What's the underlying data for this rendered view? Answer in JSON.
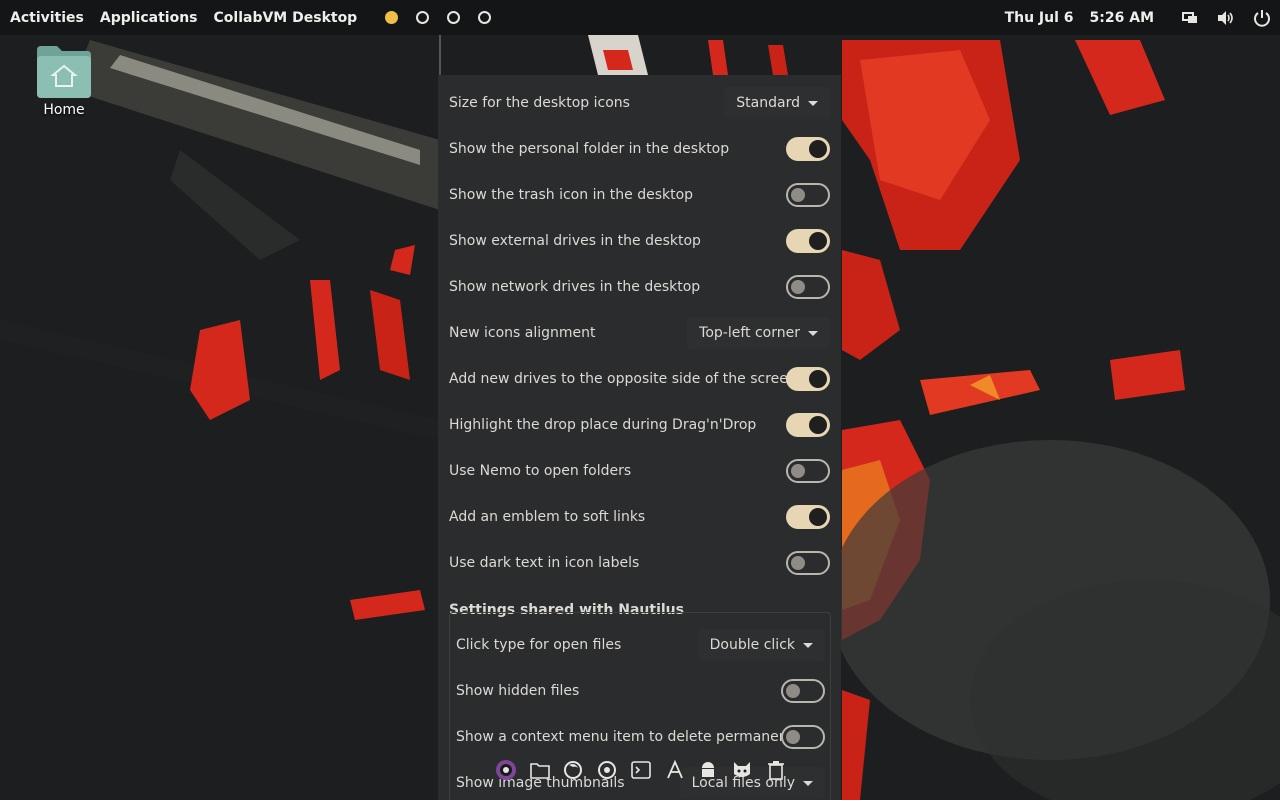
{
  "topbar": {
    "activities": "Activities",
    "applications": "Applications",
    "app_name": "CollabVM Desktop",
    "workspaces": [
      "active",
      "inactive",
      "inactive",
      "inactive"
    ],
    "date": "Thu Jul 6",
    "time": "5:26 AM",
    "icons": [
      "network-icon",
      "volume-icon",
      "power-icon"
    ]
  },
  "desktop": {
    "home_label": "Home"
  },
  "settings": {
    "rows": [
      {
        "label": "Size for the desktop icons",
        "type": "dropdown",
        "value": "Standard"
      },
      {
        "label": "Show the personal folder in the desktop",
        "type": "toggle",
        "on": true
      },
      {
        "label": "Show the trash icon in the desktop",
        "type": "toggle",
        "on": false
      },
      {
        "label": "Show external drives in the desktop",
        "type": "toggle",
        "on": true
      },
      {
        "label": "Show network drives in the desktop",
        "type": "toggle",
        "on": false
      },
      {
        "label": "New icons alignment",
        "type": "dropdown",
        "value": "Top-left corner"
      },
      {
        "label": "Add new drives to the opposite side of the screen",
        "type": "toggle",
        "on": true
      },
      {
        "label": "Highlight the drop place during Drag'n'Drop",
        "type": "toggle",
        "on": true
      },
      {
        "label": "Use Nemo to open folders",
        "type": "toggle",
        "on": false
      },
      {
        "label": "Add an emblem to soft links",
        "type": "toggle",
        "on": true
      },
      {
        "label": "Use dark text in icon labels",
        "type": "toggle",
        "on": false
      }
    ],
    "nautilus_section_title": "Settings shared with Nautilus",
    "nautilus_rows": [
      {
        "label": "Click type for open files",
        "type": "dropdown",
        "value": "Double click"
      },
      {
        "label": "Show hidden files",
        "type": "toggle",
        "on": false
      },
      {
        "label": "Show a context menu item to delete permanently",
        "type": "toggle",
        "on": false
      },
      {
        "label": "Show image thumbnails",
        "type": "dropdown",
        "value": "Local files only"
      }
    ]
  },
  "dock": {
    "icons": [
      "tor-browser-icon",
      "files-icon",
      "firefox-icon",
      "chrome-icon",
      "terminal-icon",
      "font-icon",
      "android-icon",
      "gimp-icon",
      "trash-icon"
    ]
  },
  "colors": {
    "accent": "#f1bf48",
    "toggle_on": "#e6d6b4",
    "panel_bg": "#2b2c2d",
    "wallpaper_red": "#d4281c"
  }
}
